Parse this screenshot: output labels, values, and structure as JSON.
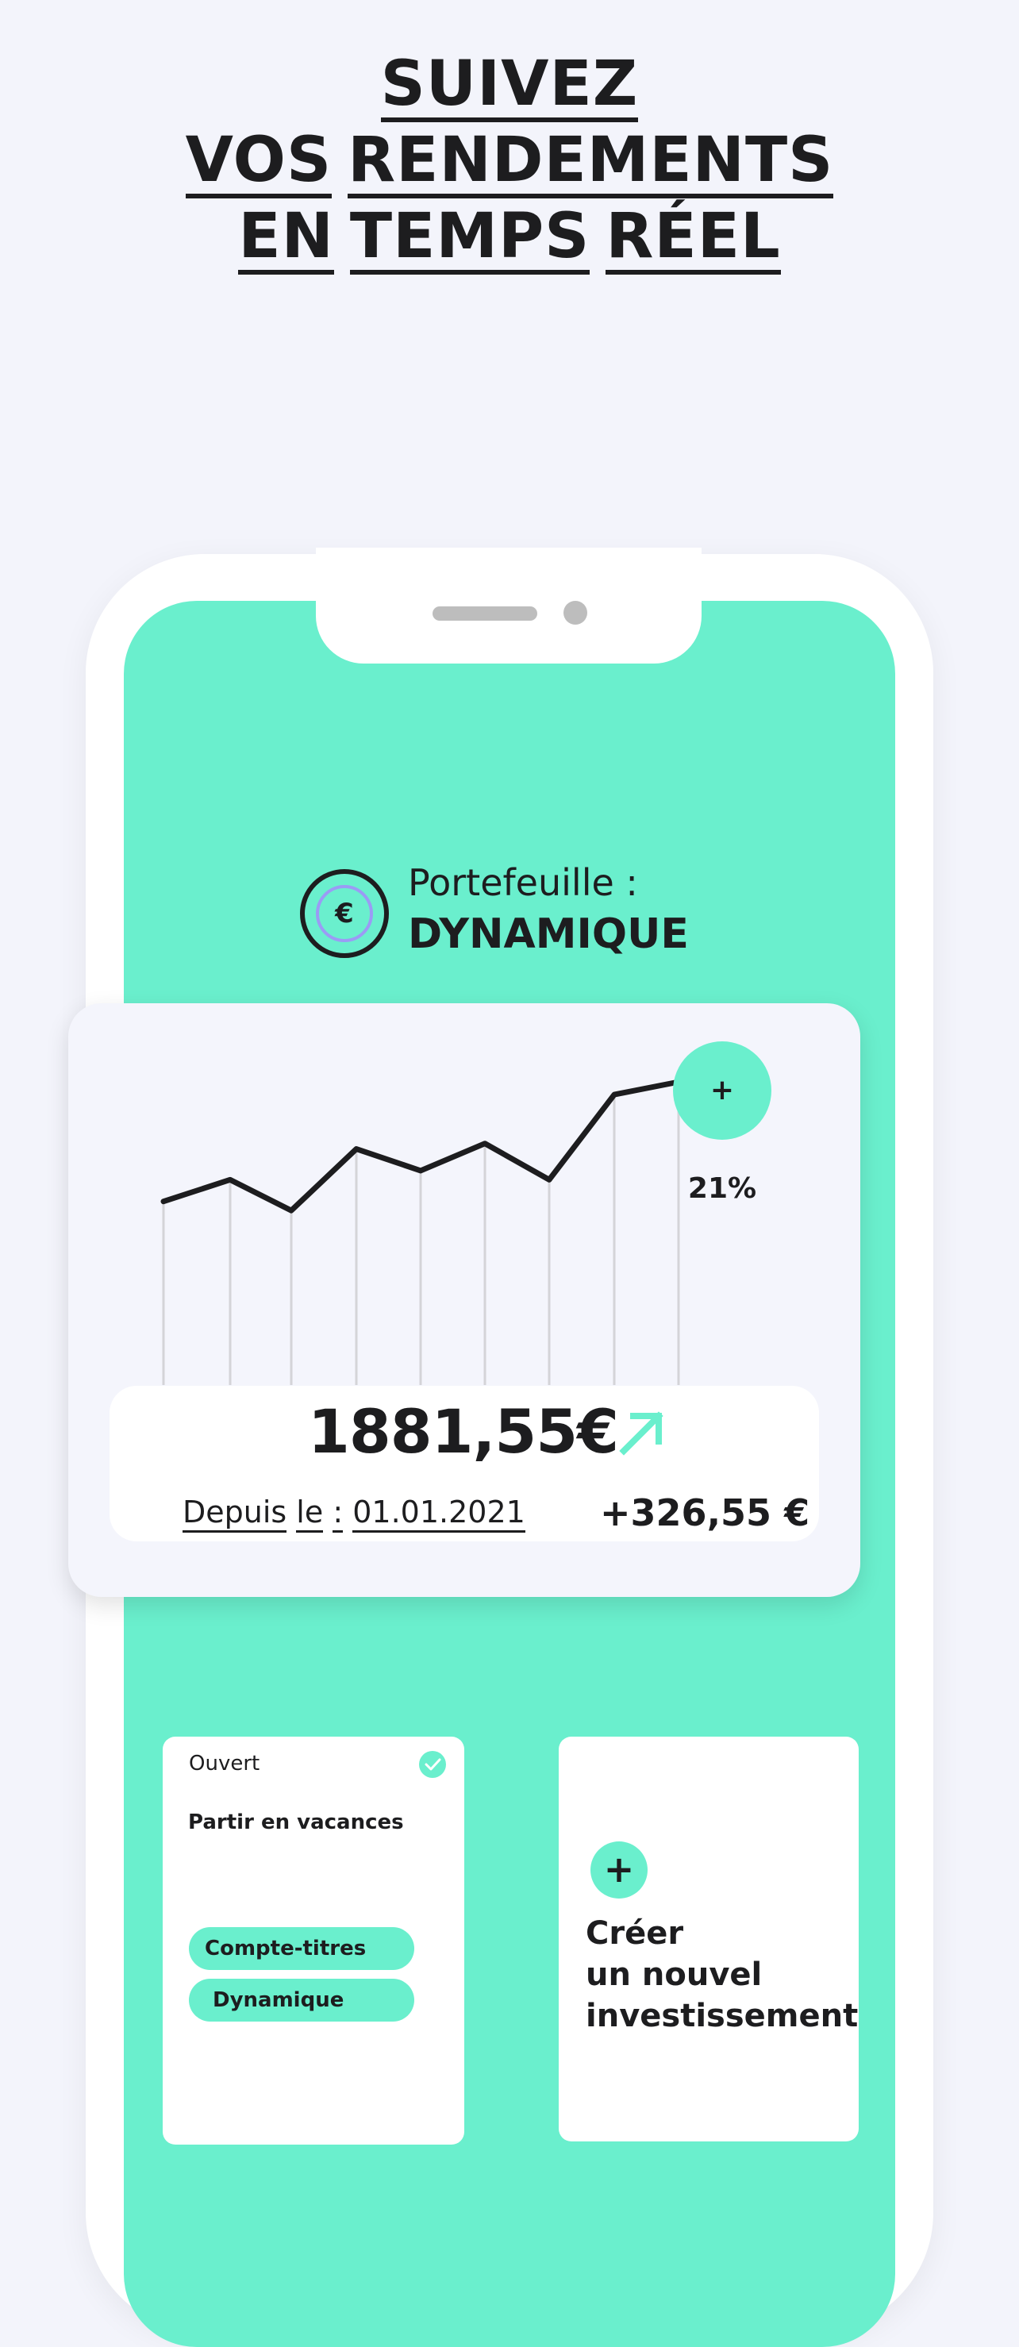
{
  "headline": {
    "line1": [
      "SUIVEZ"
    ],
    "line2": [
      "VOS",
      "RENDEMENTS"
    ],
    "line3": [
      "EN",
      "TEMPS",
      "RÉEL"
    ]
  },
  "portfolio": {
    "icon": "euro-coin-icon",
    "currency_symbol": "€",
    "label": "Portefeuille :",
    "name": "DYNAMIQUE"
  },
  "performance": {
    "percent_badge": "+ 21%",
    "total_value": "1881,55€",
    "trend_icon": "arrow-up-right-icon",
    "since_words": [
      "Depuis",
      "le",
      ":",
      "01.01.2021"
    ],
    "gain": "+326,55 €",
    "sparkline_values": [
      40,
      52,
      35,
      69,
      57,
      72,
      52,
      99,
      106
    ]
  },
  "goal_card": {
    "status": "Ouvert",
    "status_icon": "check-circle-icon",
    "title": "Partir en vacances",
    "tags": [
      "Compte-titres",
      "Dynamique"
    ]
  },
  "new_card": {
    "plus_icon": "+",
    "label_lines": [
      "Créer",
      "un nouvel",
      "investissement"
    ]
  },
  "colors": {
    "background": "#f3f4fb",
    "accent_mint": "#6aefcd",
    "ink": "#1d1d1f",
    "ring_lavender": "#9b9bf5"
  }
}
